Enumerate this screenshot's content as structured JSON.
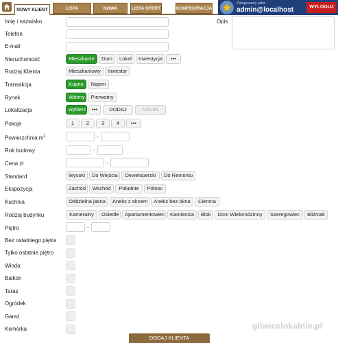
{
  "tabs": [
    "NOWY KLIENT",
    "LISTA KLIENTÓW",
    "NOWA OFERTA",
    "LISTA OFERT",
    "KONFIGURACJA"
  ],
  "user": {
    "label": "Zalogowany jako:",
    "name": "admin@localhost",
    "logout": "WYLOGUJ"
  },
  "fields": {
    "name": "Imię i nazwisko",
    "phone": "Telefon",
    "email": "E-mail",
    "opis": "Opis",
    "nieruchomosc": "Nieruchomość",
    "rodzaj_klienta": "Rodzaj Klienta",
    "transakcja": "Transakcja",
    "rynek": "Rynek",
    "lokalizacja": "Lokalizacja",
    "pokoje": "Pokoje",
    "powierzchnia": "Powierzchnia m",
    "powierzchnia_sup": "2",
    "rok": "Rok budowy",
    "cena": "Cena zł",
    "standard": "Standard",
    "ekspozycja": "Ekspozycja",
    "kuchnia": "Kuchnia",
    "rodzaj_budynku": "Rodzaj budynku",
    "pietro": "Piętro",
    "bez_ostatniego": "Bez ostatniego piętra",
    "tylko_ostatnie": "Tylko ostatnie piętro",
    "winda": "Winda",
    "balkon": "Balkon",
    "taras": "Taras",
    "ogrodek": "Ogródek",
    "garaz": "Garaż",
    "komorka": "Komórka"
  },
  "options": {
    "nieruchomosc": [
      "Mieszkanie",
      "Dom",
      "Lokal",
      "Inwestycja",
      "•••"
    ],
    "rodzaj_klienta": [
      "Mieszkaniowy",
      "Inwestor"
    ],
    "transakcja": [
      "Kupno",
      "Najem"
    ],
    "rynek": [
      "Wtórny",
      "Pierwotny"
    ],
    "lokalizacja": [
      "wybierz",
      "•••",
      "DODAJ",
      "USUŃ"
    ],
    "pokoje": [
      "1",
      "2",
      "3",
      "4",
      "•••"
    ],
    "standard": [
      "Wysoki",
      "Do Wejścia",
      "Deweloperski",
      "Do Remontu"
    ],
    "ekspozycja": [
      "Zachód",
      "Wschód",
      "Południe",
      "Północ"
    ],
    "kuchnia": [
      "Oddzielna jasna",
      "Aneks z oknem",
      "Aneks bez okna",
      "Ciemna"
    ],
    "rodzaj_budynku": [
      "Kameralny",
      "Osiedle",
      "Apartamentowiec",
      "Kamienica",
      "Blok",
      "Dom Wielorodzinny",
      "Szeregowiec",
      "Bliźniak"
    ]
  },
  "range_sep": "-",
  "submit": "DODAJ KLIENTA",
  "watermark": "gliwicelokalnie.pl",
  "colors": {
    "brown": "#8b6b3d",
    "green": "#2a9a2a",
    "navy": "#1e3f7a",
    "red": "#c81e1e"
  }
}
